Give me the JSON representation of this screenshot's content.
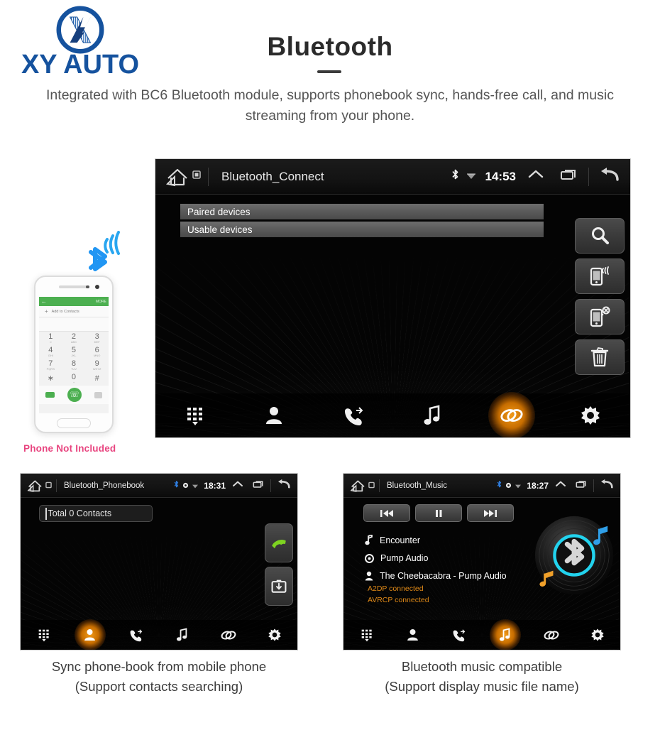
{
  "brand": {
    "logo_icon": "xy-auto-x-monogram",
    "name": "XY AUTO",
    "color": "#15529e"
  },
  "header": {
    "title": "Bluetooth",
    "subtitle": "Integrated with BC6 Bluetooth module, supports phonebook sync, hands-free call, and music streaming from your phone."
  },
  "phone_illustration": {
    "bluetooth_icon": "bluetooth-broadcast-icon",
    "appbar_back": "←",
    "appbar_more": "MORE",
    "add_contact_label": "Add to Contacts",
    "keys": [
      {
        "digit": "1",
        "sub": "∞"
      },
      {
        "digit": "2",
        "sub": "ABC"
      },
      {
        "digit": "3",
        "sub": "DEF"
      },
      {
        "digit": "4",
        "sub": "GHI"
      },
      {
        "digit": "5",
        "sub": "JKL"
      },
      {
        "digit": "6",
        "sub": "MNO"
      },
      {
        "digit": "7",
        "sub": "PQRS"
      },
      {
        "digit": "8",
        "sub": "TUV"
      },
      {
        "digit": "9",
        "sub": "WXYZ"
      },
      {
        "digit": "∗",
        "sub": ""
      },
      {
        "digit": "0",
        "sub": "+"
      },
      {
        "digit": "#",
        "sub": ""
      }
    ],
    "action_icons": [
      "video-call-icon",
      "call-icon",
      "backspace-icon"
    ],
    "not_included_note": "Phone Not Included",
    "not_included_color": "#e8447f"
  },
  "main_unit": {
    "statusbar": {
      "home_icon": "home-icon",
      "sd_icon": "sdcard-icon",
      "title": "Bluetooth_Connect",
      "bluetooth_icon": "bluetooth-icon",
      "wifi_icon": "wifi-icon",
      "time": "14:53",
      "expand_icon": "chevron-up-icon",
      "recents_icon": "recent-apps-icon",
      "back_icon": "back-arrow-icon"
    },
    "device_lists": [
      {
        "label": "Paired devices"
      },
      {
        "label": "Usable devices"
      }
    ],
    "side_buttons": [
      {
        "icon": "search-icon",
        "name": "search-devices-button"
      },
      {
        "icon": "phone-connect-icon",
        "name": "connect-device-button"
      },
      {
        "icon": "phone-disconnect-icon",
        "name": "disconnect-device-button"
      },
      {
        "icon": "trash-icon",
        "name": "delete-device-button"
      }
    ],
    "nav": [
      {
        "icon": "dialpad-icon",
        "name": "dialpad",
        "active": false
      },
      {
        "icon": "contacts-icon",
        "name": "contacts",
        "active": false
      },
      {
        "icon": "call-history-icon",
        "name": "call-history",
        "active": false
      },
      {
        "icon": "music-note-icon",
        "name": "music",
        "active": false
      },
      {
        "icon": "link-icon",
        "name": "connection",
        "active": true
      },
      {
        "icon": "gear-icon",
        "name": "settings",
        "active": false
      }
    ],
    "active_color": "#ff9e1b"
  },
  "phonebook_unit": {
    "statusbar": {
      "home_icon": "home-icon",
      "sd_icon": "sdcard-icon",
      "title": "Bluetooth_Phonebook",
      "bluetooth_icon": "bluetooth-icon",
      "gps_icon": "location-icon",
      "wifi_icon": "wifi-icon",
      "time": "18:31",
      "expand_icon": "chevron-up-icon",
      "recents_icon": "recent-apps-icon",
      "back_icon": "back-arrow-icon"
    },
    "search_value": "Total 0 Contacts",
    "search_placeholder": "Total 0 Contacts",
    "side_buttons": [
      {
        "icon": "call-icon",
        "name": "dial-button"
      },
      {
        "icon": "download-contacts-icon",
        "name": "sync-contacts-button"
      }
    ],
    "nav": [
      {
        "icon": "dialpad-icon",
        "name": "dialpad",
        "active": false
      },
      {
        "icon": "contacts-icon",
        "name": "contacts",
        "active": true
      },
      {
        "icon": "call-history-icon",
        "name": "call-history",
        "active": false
      },
      {
        "icon": "music-note-icon",
        "name": "music",
        "active": false
      },
      {
        "icon": "link-icon",
        "name": "connection",
        "active": false
      },
      {
        "icon": "gear-icon",
        "name": "settings",
        "active": false
      }
    ],
    "caption_line1": "Sync phone-book from mobile phone",
    "caption_line2": "(Support contacts searching)"
  },
  "music_unit": {
    "statusbar": {
      "home_icon": "home-icon",
      "sd_icon": "sdcard-icon",
      "title": "Bluetooth_Music",
      "bluetooth_icon": "bluetooth-icon",
      "gps_icon": "location-icon",
      "wifi_icon": "wifi-icon",
      "time": "18:27",
      "expand_icon": "chevron-up-icon",
      "recents_icon": "recent-apps-icon",
      "back_icon": "back-arrow-icon"
    },
    "transport": [
      {
        "icon": "previous-track-icon",
        "name": "previous-button"
      },
      {
        "icon": "pause-icon",
        "name": "pause-button"
      },
      {
        "icon": "next-track-icon",
        "name": "next-button"
      }
    ],
    "track": {
      "title_icon": "music-note-icon",
      "title": "Encounter",
      "album_icon": "disc-icon",
      "album": "Pump Audio",
      "artist_icon": "person-icon",
      "artist": "The Cheebacabra - Pump Audio"
    },
    "status_lines": [
      "A2DP connected",
      "AVRCP connected"
    ],
    "status_color": "#e08a18",
    "album_art_icon": "vinyl-bluetooth-icon",
    "nav": [
      {
        "icon": "dialpad-icon",
        "name": "dialpad",
        "active": false
      },
      {
        "icon": "contacts-icon",
        "name": "contacts",
        "active": false
      },
      {
        "icon": "call-history-icon",
        "name": "call-history",
        "active": false
      },
      {
        "icon": "music-note-icon",
        "name": "music",
        "active": true
      },
      {
        "icon": "link-icon",
        "name": "connection",
        "active": false
      },
      {
        "icon": "gear-icon",
        "name": "settings",
        "active": false
      }
    ],
    "caption_line1": "Bluetooth music compatible",
    "caption_line2": "(Support display music file name)"
  }
}
